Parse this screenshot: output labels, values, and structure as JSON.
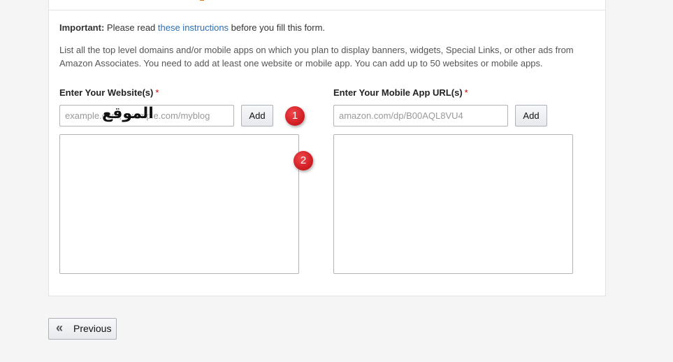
{
  "notice": {
    "important_label": "Important:",
    "text_before": " Please read ",
    "link_text": "these instructions",
    "text_after": " before you fill this form."
  },
  "description": "List all the top level domains and/or mobile apps on which you plan to display banners, widgets, Special Links, or other ads from Amazon Associates. You need to add at least one website or mobile app. You can add up to 50 websites or mobile apps.",
  "websites": {
    "label": "Enter Your Website(s)",
    "required_mark": "*",
    "input_placeholder": "example.com, example.com/myblog",
    "add_label": "Add"
  },
  "apps": {
    "label": "Enter Your Mobile App URL(s)",
    "required_mark": "*",
    "input_placeholder": "amazon.com/dp/B00AQL8VU4",
    "add_label": "Add"
  },
  "annotations": {
    "badge_1": "1",
    "badge_2": "2",
    "watermark": "الموقع"
  },
  "navigation": {
    "previous_label": "Previous",
    "previous_icon": "double-chevron-left-icon"
  },
  "colors": {
    "link": "#2a6fb6",
    "required": "#c40000",
    "badge": "#d9232a",
    "accent": "#e47911"
  }
}
